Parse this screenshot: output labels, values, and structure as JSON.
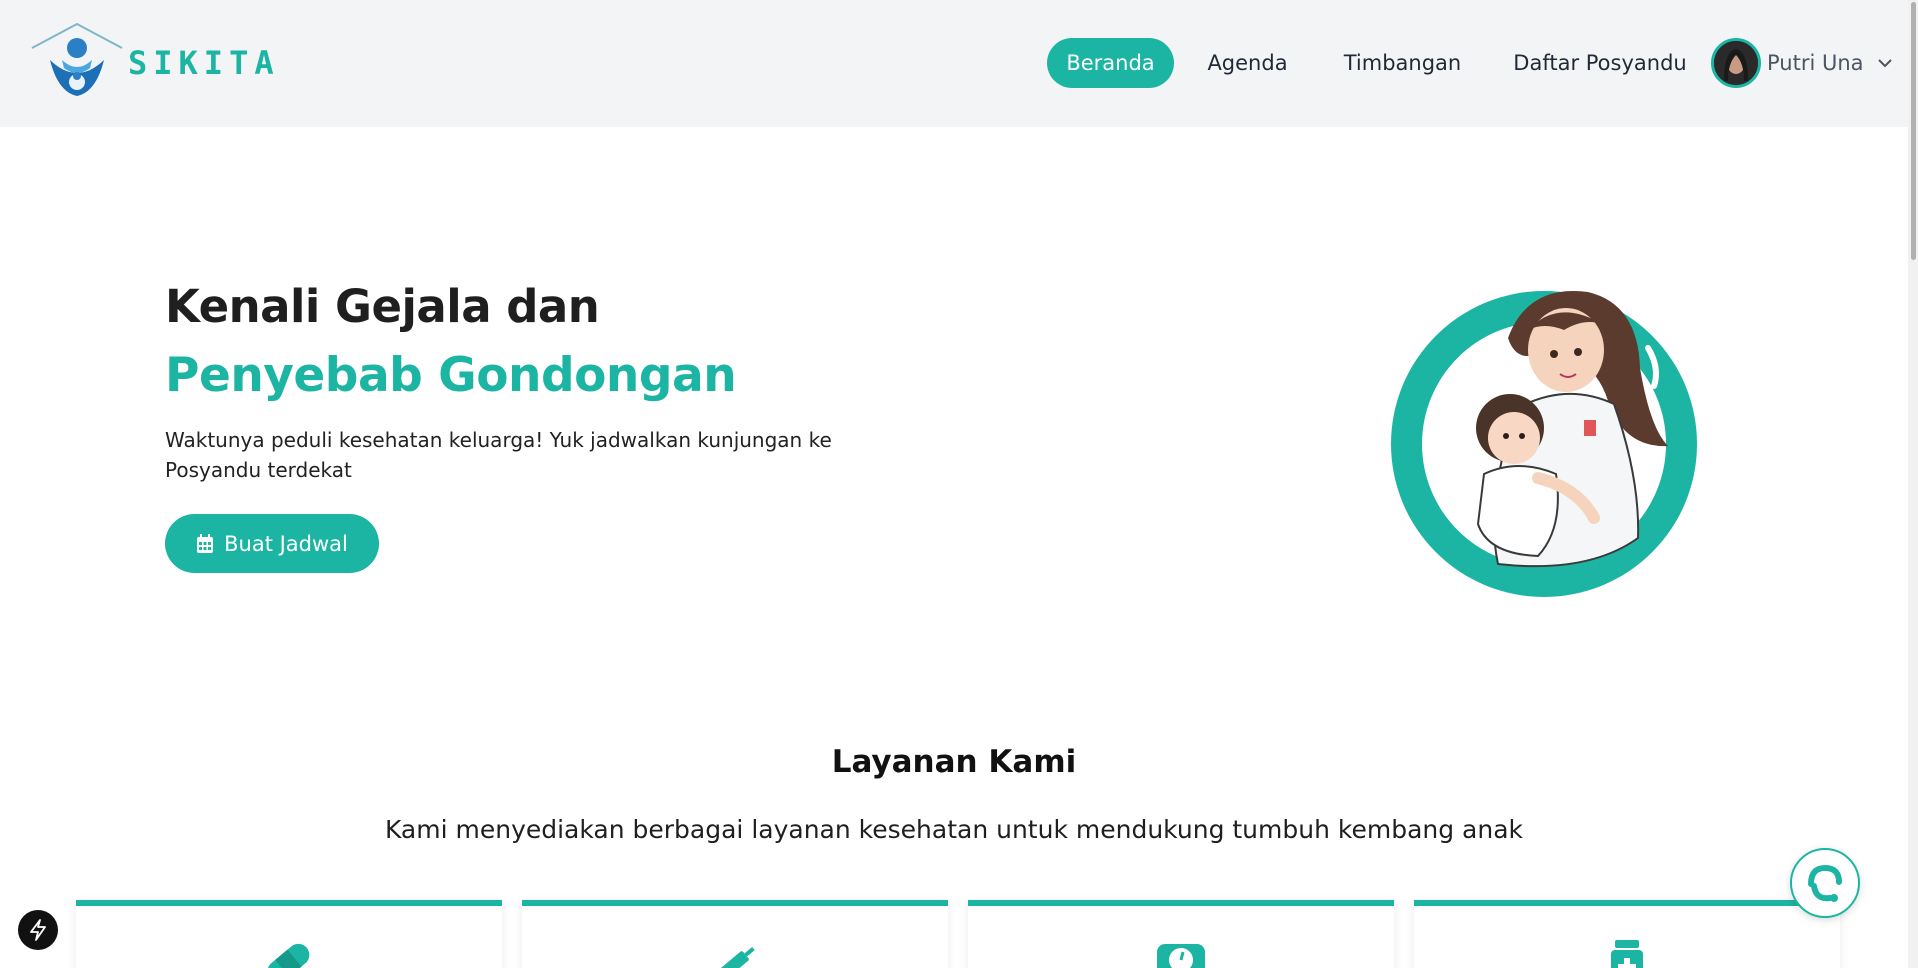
{
  "brand": {
    "name": "SIKITA"
  },
  "nav": {
    "items": [
      {
        "label": "Beranda",
        "active": true
      },
      {
        "label": "Agenda",
        "active": false
      },
      {
        "label": "Timbangan",
        "active": false
      },
      {
        "label": "Daftar Posyandu",
        "active": false
      }
    ]
  },
  "user": {
    "name": "Putri Una"
  },
  "hero": {
    "title_line1": "Kenali Gejala dan",
    "title_line2": "Penyebab Gondongan",
    "description": "Waktunya peduli kesehatan keluarga! Yuk jadwalkan kunjungan ke Posyandu terdekat",
    "cta_label": "Buat Jadwal"
  },
  "services": {
    "title": "Layanan Kami",
    "subtitle": "Kami menyediakan berbagai layanan kesehatan untuk mendukung tumbuh kembang anak",
    "cards": [
      {
        "icon": "bandage-icon"
      },
      {
        "icon": "syringe-icon"
      },
      {
        "icon": "weight-scale-icon"
      },
      {
        "icon": "medicine-bottle-icon"
      }
    ]
  },
  "colors": {
    "accent": "#1cb5a3",
    "header_bg": "#f3f4f6",
    "text": "#1f1f1f"
  }
}
